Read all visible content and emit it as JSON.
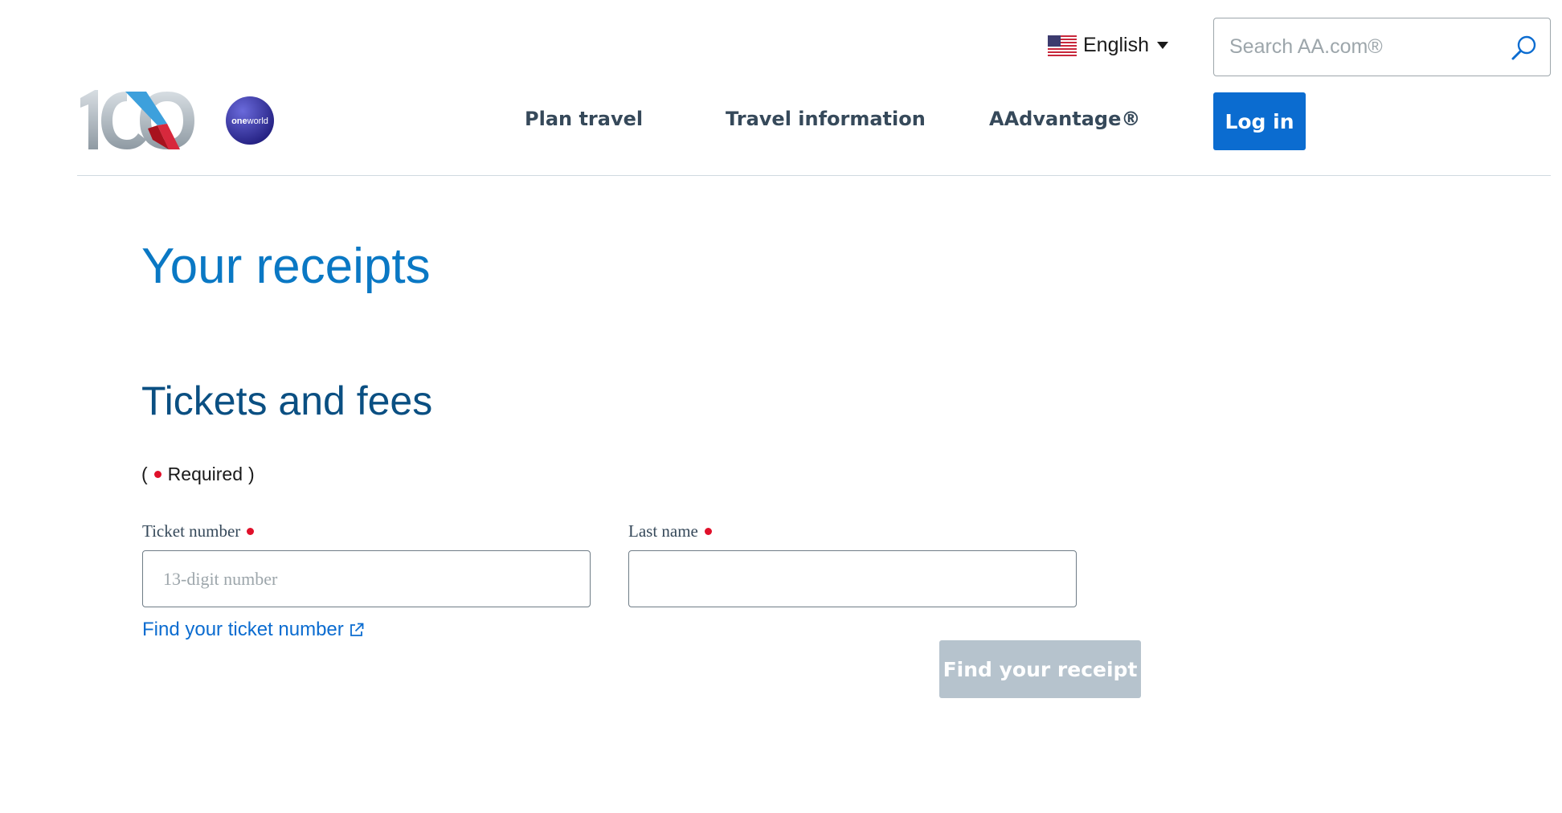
{
  "header": {
    "language": {
      "label": "English",
      "flag_icon": "us-flag-icon"
    },
    "search": {
      "placeholder": "Search AA.com®"
    },
    "logo": {
      "icon": "aa-100-logo",
      "partner_icon": "oneworld-logo",
      "partner_text": "oneworld"
    },
    "nav": [
      {
        "label": "Plan travel"
      },
      {
        "label": "Travel information"
      },
      {
        "label": "AAdvantage®"
      }
    ],
    "login_label": "Log in"
  },
  "main": {
    "title": "Your receipts",
    "section_title": "Tickets and fees",
    "required_open": "(",
    "required_label": "Required",
    "required_close": ")",
    "ticket_field": {
      "label": "Ticket number",
      "placeholder": "13-digit number",
      "value": ""
    },
    "last_name_field": {
      "label": "Last name",
      "placeholder": "",
      "value": ""
    },
    "find_ticket_link": "Find your ticket number",
    "submit_label": "Find your receipt"
  },
  "colors": {
    "accent": "#0b6cd0",
    "title": "#0a78c4",
    "section_title": "#0a4f82",
    "required_dot": "#e0102a",
    "disabled_button": "#b6c3cd"
  }
}
